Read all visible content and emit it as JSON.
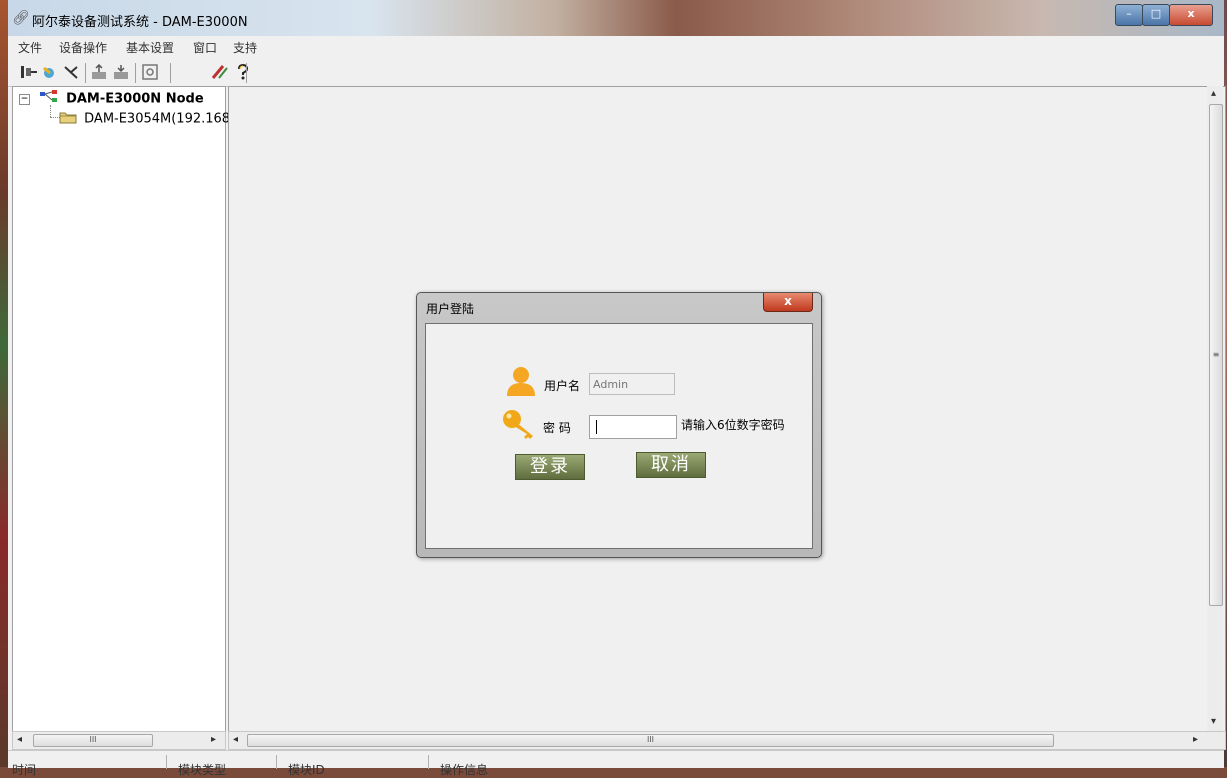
{
  "window": {
    "title": "阿尔泰设备测试系统 - DAM-E3000N",
    "min_glyph": "–",
    "max_glyph": "□",
    "close_glyph": "x"
  },
  "menu": {
    "items": [
      "文件",
      "设备操作",
      "基本设置",
      "窗口",
      "支持"
    ]
  },
  "toolbar": {
    "icons": [
      "connect-icon",
      "search-device-icon",
      "disconnect-icon",
      "device-up-icon",
      "device-down-icon",
      "settings-icon",
      "tool-icon",
      "help-icon"
    ]
  },
  "tree": {
    "root_label": "DAM-E3000N Node",
    "child_label": "DAM-E3054M(192.168",
    "expander": "−"
  },
  "scroll": {
    "thumb_grip": "III",
    "vgrip": "≡",
    "left": "◂",
    "right": "▸",
    "up": "▴",
    "down": "▾"
  },
  "status": {
    "col1": "时间",
    "col2": "模块类型",
    "col3": "模块ID",
    "col4": "操作信息"
  },
  "dialog": {
    "title": "用户登陆",
    "close": "x",
    "username_label": "用户名",
    "username_value": "Admin",
    "password_label": "密  码",
    "password_hint": "请输入6位数字密码",
    "login_button": "登录",
    "cancel_button": "取消"
  },
  "colors": {
    "button_green_top": "#9aa874",
    "button_green_bottom": "#5f6d3e",
    "user_icon": "#f5a623",
    "key_icon": "#f0a818"
  }
}
